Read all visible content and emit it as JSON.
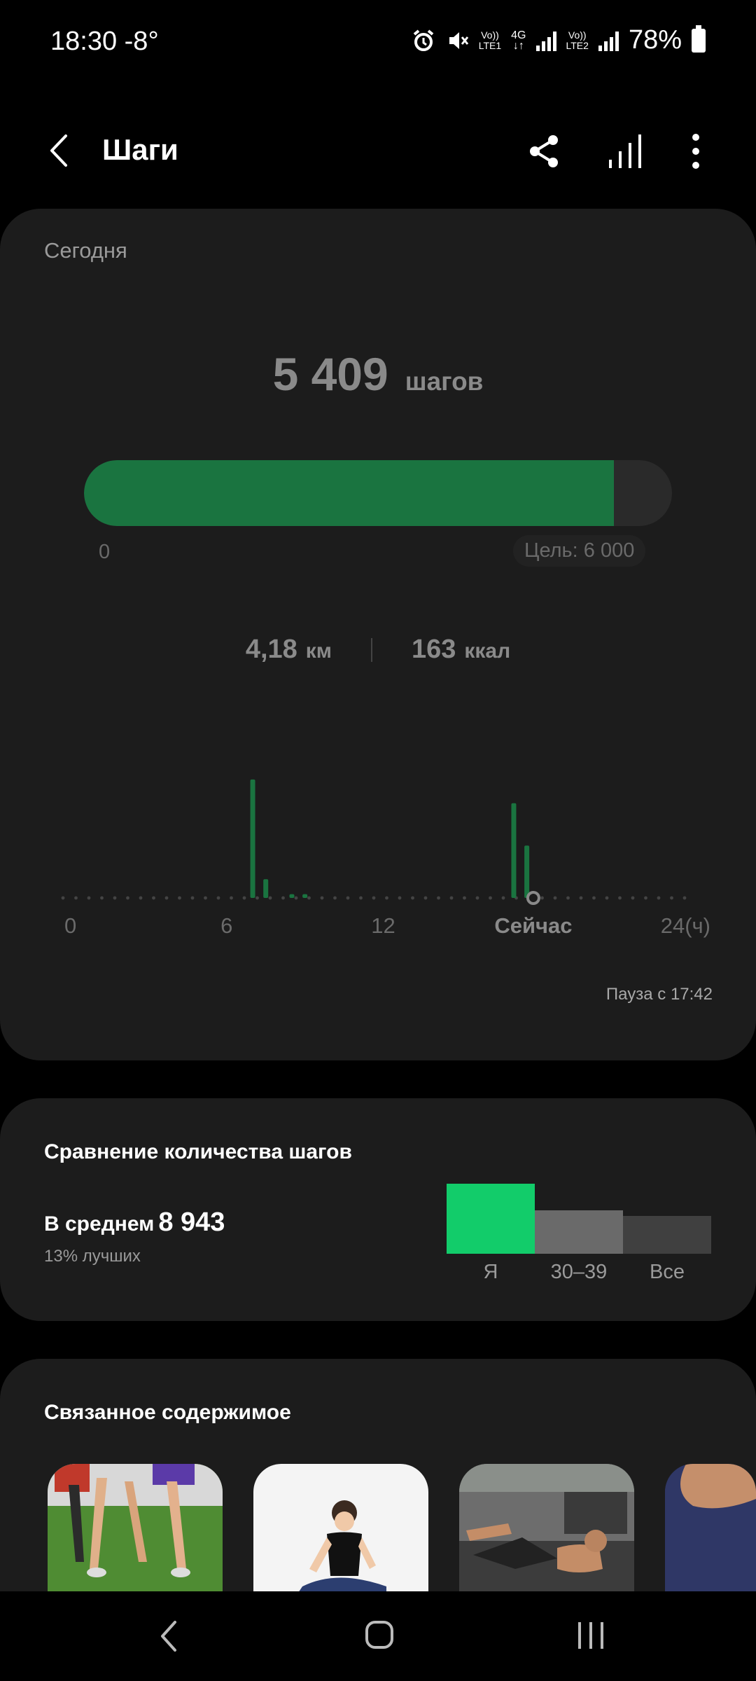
{
  "status_bar": {
    "time": "18:30",
    "temperature": "-8°",
    "sim1_label_top": "Vo))",
    "sim1_label_bottom": "LTE1",
    "net_label": "4G",
    "sim2_label_top": "Vo))",
    "sim2_label_bottom": "LTE2",
    "battery": "78%"
  },
  "app_bar": {
    "title": "Шаги",
    "icons": [
      "back-icon",
      "share-icon",
      "stats-icon",
      "more-icon"
    ]
  },
  "today_card": {
    "label": "Сегодня",
    "steps_value": "5 409",
    "steps_unit": "шагов",
    "progress_fraction": 0.9015,
    "progress_min": "0",
    "goal_label": "Цель: 6 000",
    "distance_value": "4,18",
    "distance_unit": "км",
    "calories_value": "163",
    "calories_unit": "ккал",
    "pause_text": "Пауза с 17:42",
    "accent_color": "#1a7440"
  },
  "chart_data": {
    "type": "bar",
    "x_tick_labels": [
      "0",
      "6",
      "12",
      "Сейчас",
      "24(ч)"
    ],
    "x_tick_positions_hours": [
      0,
      6,
      12,
      17.75,
      24
    ],
    "xlim": [
      0,
      24
    ],
    "bars": [
      {
        "hour": 7.0,
        "value": 0.95
      },
      {
        "hour": 7.5,
        "value": 0.15
      },
      {
        "hour": 8.5,
        "value": 0.03
      },
      {
        "hour": 9.0,
        "value": 0.03
      },
      {
        "hour": 17.0,
        "value": 0.76
      },
      {
        "hour": 17.5,
        "value": 0.42
      }
    ],
    "now_hour": 17.75,
    "bar_color": "#1a7440"
  },
  "comparison": {
    "title": "Сравнение количества шагов",
    "average_label": "В среднем",
    "average_value": "8 943",
    "percentile_text": "13% лучших",
    "groups": [
      {
        "label": "Я",
        "relative": 1.0,
        "color": "#12cc6a"
      },
      {
        "label": "30–39",
        "relative": 0.62,
        "color": "#6a6a6a"
      },
      {
        "label": "Все",
        "relative": 0.54,
        "color": "#404040"
      }
    ]
  },
  "related": {
    "title": "Связанное содержимое",
    "items": [
      "running-thumbnail",
      "stretching-thumbnail",
      "crunches-thumbnail",
      "arm-thumbnail"
    ]
  },
  "nav_bar": {
    "icons": [
      "nav-back-icon",
      "nav-home-icon",
      "nav-recents-icon"
    ]
  }
}
